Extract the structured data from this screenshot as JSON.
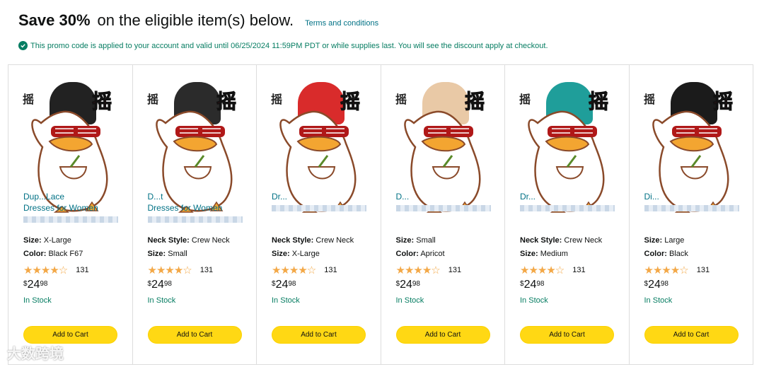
{
  "header": {
    "headline_bold": "Save 30%",
    "headline_rest": "on the eligible item(s) below.",
    "terms_link": "Terms and conditions"
  },
  "promo": {
    "text": "This promo code is applied to your account and valid until 06/25/2024 11:59PM PDT or while supplies last. You will see the discount apply at checkout."
  },
  "products": [
    {
      "title_line1": "Dup...Lace",
      "title_line2": "Dresses for Women",
      "attr1_label": "Size:",
      "attr1_value": "X-Large",
      "attr2_label": "Color:",
      "attr2_value": "Black F67",
      "rating": "4.5",
      "reviews": "131",
      "price_currency": "$",
      "price_whole": "24",
      "price_fraction": "98",
      "stock": "In Stock",
      "cart_label": "Add to Cart",
      "dress_color": "#222222"
    },
    {
      "title_line1": "D...t",
      "title_line2": "Dresses for Women",
      "attr1_label": "Neck Style:",
      "attr1_value": "Crew Neck",
      "attr2_label": "Size:",
      "attr2_value": "Small",
      "rating": "4.5",
      "reviews": "131",
      "price_currency": "$",
      "price_whole": "24",
      "price_fraction": "98",
      "stock": "In Stock",
      "cart_label": "Add to Cart",
      "dress_color": "#2b2b2b"
    },
    {
      "title_line1": "Dr...",
      "title_line2": "",
      "attr1_label": "Neck Style:",
      "attr1_value": "Crew Neck",
      "attr2_label": "Size:",
      "attr2_value": "X-Large",
      "rating": "4.5",
      "reviews": "131",
      "price_currency": "$",
      "price_whole": "24",
      "price_fraction": "98",
      "stock": "In Stock",
      "cart_label": "Add to Cart",
      "dress_color": "#d92b2b"
    },
    {
      "title_line1": "D...",
      "title_line2": "",
      "attr1_label": "Size:",
      "attr1_value": "Small",
      "attr2_label": "Color:",
      "attr2_value": "Apricot",
      "rating": "4.5",
      "reviews": "131",
      "price_currency": "$",
      "price_whole": "24",
      "price_fraction": "98",
      "stock": "In Stock",
      "cart_label": "Add to Cart",
      "dress_color": "#e9c9a6"
    },
    {
      "title_line1": "Dr...",
      "title_line2": "",
      "attr1_label": "Neck Style:",
      "attr1_value": "Crew Neck",
      "attr2_label": "Size:",
      "attr2_value": "Medium",
      "rating": "4.5",
      "reviews": "131",
      "price_currency": "$",
      "price_whole": "24",
      "price_fraction": "98",
      "stock": "In Stock",
      "cart_label": "Add to Cart",
      "dress_color": "#1f9e9a"
    },
    {
      "title_line1": "Di...",
      "title_line2": "",
      "attr1_label": "Size:",
      "attr1_value": "Large",
      "attr2_label": "Color:",
      "attr2_value": "Black",
      "rating": "4.5",
      "reviews": "131",
      "price_currency": "$",
      "price_whole": "24",
      "price_fraction": "98",
      "stock": "In Stock",
      "cart_label": "Add to Cart",
      "dress_color": "#1b1b1b"
    }
  ],
  "watermark": "大数跨境"
}
